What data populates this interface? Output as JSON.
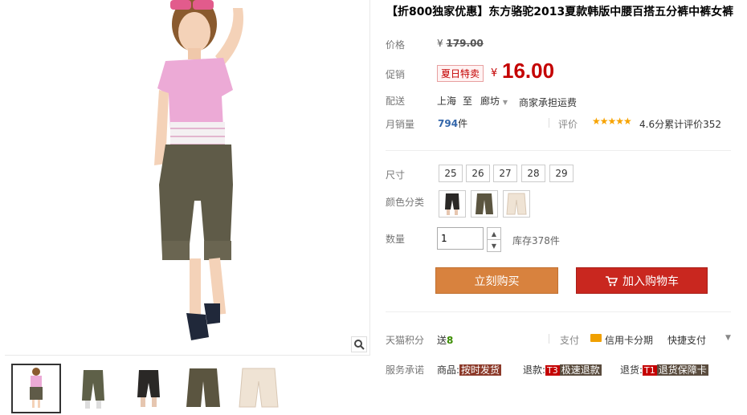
{
  "title": "【折800独家优惠】东方骆驼2013夏款韩版中腰百搭五分裤中裤女裤",
  "price": {
    "label": "价格",
    "currency": "¥",
    "value": "179.00"
  },
  "promo": {
    "label": "促销",
    "badge": "夏日特卖",
    "currency": "¥",
    "value": "16.00"
  },
  "shipping": {
    "label": "配送",
    "from": "上海",
    "to_word": "至",
    "to": "廊坊",
    "fee": "商家承担运费"
  },
  "sales": {
    "label": "月销量",
    "count": "794",
    "unit": "件"
  },
  "rating": {
    "label": "评价",
    "stars": "★★★★★",
    "text": "4.6分累计评价352"
  },
  "size": {
    "label": "尺寸",
    "options": [
      "25",
      "26",
      "27",
      "28",
      "29"
    ]
  },
  "color": {
    "label": "颜色分类"
  },
  "quantity": {
    "label": "数量",
    "value": "1",
    "stock": "库存378件"
  },
  "buttons": {
    "buy_now": "立刻购买",
    "add_cart": "加入购物车"
  },
  "tmall_points": {
    "label": "天猫积分",
    "prefix": "送",
    "value": "8"
  },
  "payment": {
    "label": "支付",
    "card": "信用卡分期",
    "quick": "快捷支付"
  },
  "service": {
    "label": "服务承诺",
    "goods_label": "商品:",
    "goods_tag": "按时发货",
    "refund_label": "退款:",
    "refund_badge": "T3",
    "refund_tag": "极速退款",
    "return_label": "退货:",
    "return_badge": "T1",
    "return_tag": "退货保障卡"
  },
  "colors": {
    "promo_red": "#c40000",
    "buy_orange": "#d8823e",
    "cart_red": "#c9271f"
  }
}
